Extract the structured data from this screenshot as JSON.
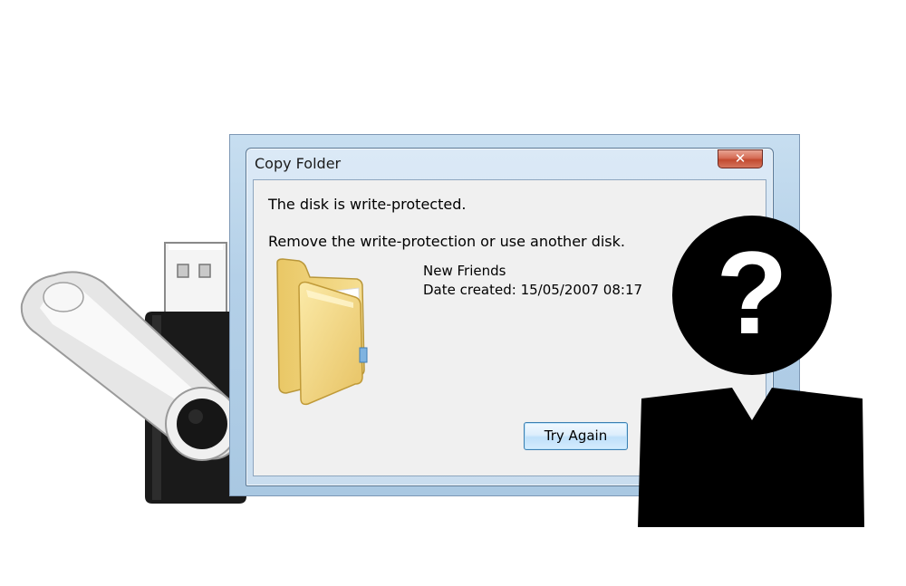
{
  "dialog": {
    "title": "Copy Folder",
    "close_glyph": "✕",
    "message_primary": "The disk is write-protected.",
    "message_secondary": "Remove the write-protection or use another disk.",
    "item": {
      "name": "New Friends",
      "date_created": "Date created: 15/05/2007 08:17",
      "icon": "folder-icon"
    },
    "try_again_label": "Try Again"
  },
  "illustrations": {
    "usb_drive": "usb-drive-icon",
    "person": "anonymous-person-icon",
    "question_mark": "?"
  },
  "colors": {
    "close_button": "#c24a2f",
    "dialog_frame": "#b4d0e8",
    "dialog_client": "#f0f0f0",
    "button_border": "#3c7fb1",
    "silhouette": "#000000"
  }
}
